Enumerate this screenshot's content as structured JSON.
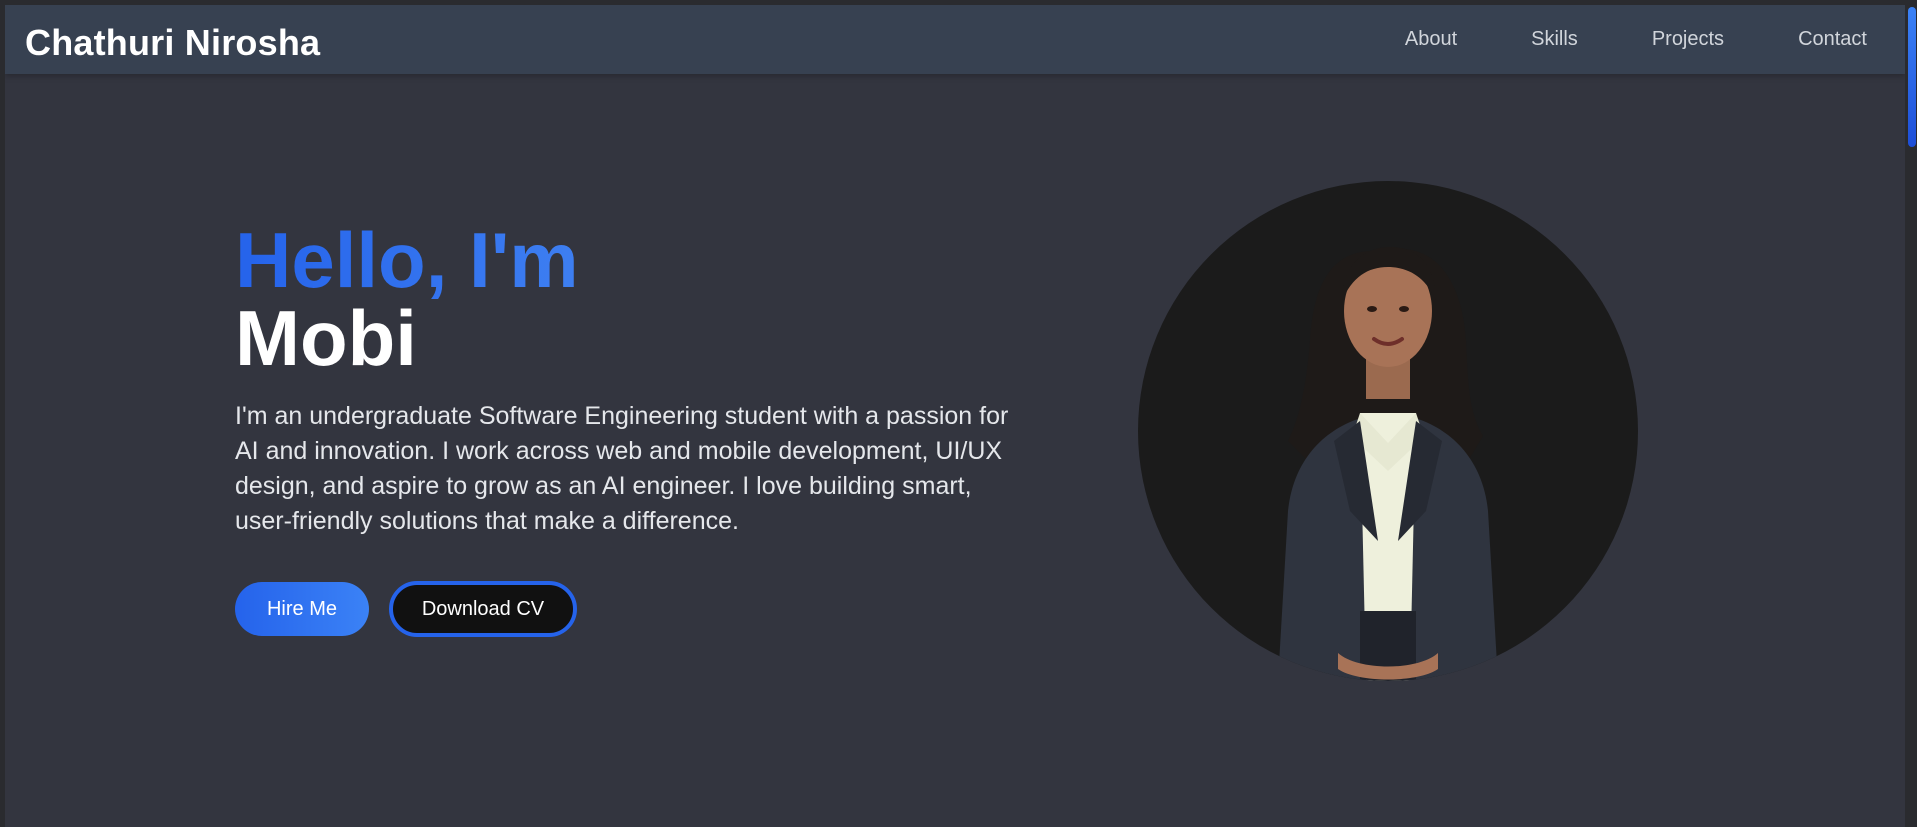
{
  "nav": {
    "brand": "Chathuri Nirosha",
    "links": [
      "About",
      "Skills",
      "Projects",
      "Contact"
    ]
  },
  "hero": {
    "greeting": "Hello, I'm",
    "name": "Mobi",
    "bio": "I'm an undergraduate Software Engineering student with a passion for AI and innovation. I work across web and mobile development, UI/UX design, and aspire to grow as an AI engineer. I love building smart, user-friendly solutions that make a difference.",
    "hire_label": "Hire Me",
    "cv_label": "Download CV"
  },
  "colors": {
    "accent": "#2563eb",
    "accent_light": "#60a5fa",
    "navbar": "#374151",
    "background": "#33353f"
  }
}
